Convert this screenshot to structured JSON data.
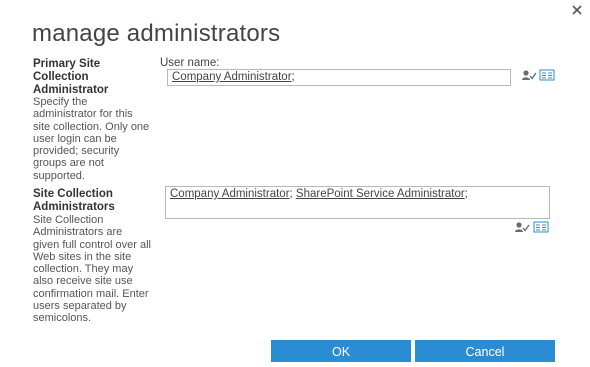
{
  "dialog": {
    "title": "manage administrators",
    "close_icon": "close-icon"
  },
  "primary_admin": {
    "heading": "Primary Site Collection Administrator",
    "description": "Specify the administrator for this site collection. Only one user login can be provided; security groups are not supported.",
    "field_label": "User name:",
    "users": [
      "Company Administrator"
    ]
  },
  "site_collection_admins": {
    "heading": "Site Collection Administrators",
    "description": "Site Collection Administrators are given full control over all Web sites in the site collection. They may also receive site use confirmation mail. Enter users separated by semicolons.",
    "users": [
      "Company Administrator",
      "SharePoint Service Administrator"
    ]
  },
  "icons": {
    "check_names": "check-names-icon",
    "browse": "address-book-icon"
  },
  "buttons": {
    "ok": "OK",
    "cancel": "Cancel"
  },
  "colors": {
    "button_bg": "#2a8dd4",
    "title_text": "#444444"
  }
}
